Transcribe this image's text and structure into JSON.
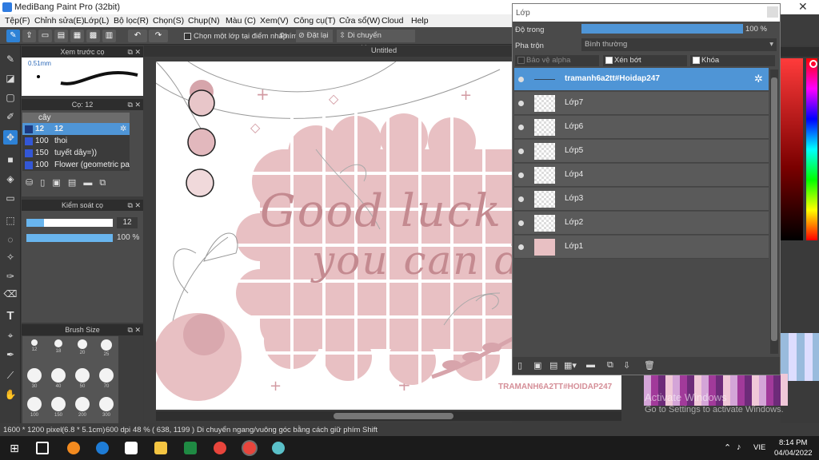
{
  "app": {
    "title": "MediBang Paint Pro (32bit)",
    "close": "✕"
  },
  "menu": [
    "Tệp(F)",
    "Chỉnh sửa(E)",
    "Lớp(L)",
    "Bộ lọc(R)",
    "Chọn(S)",
    "Chụp(N)",
    "Màu (C)",
    "Xem(V)",
    "Công cụ(T)",
    "Cửa sổ(W)",
    "Cloud",
    "Help"
  ],
  "toolbar": {
    "checkbox_label": "Chọn một lớp tại điểm nhấp",
    "snap_label": "Phím",
    "reset_label": "Đặt lại",
    "move_label": "Di chuyển ngang/dọc"
  },
  "preview": {
    "title": "Xem trước cọ",
    "size": "0.51mm"
  },
  "brush_panel": {
    "title": "Cọ: 12",
    "group": "cây",
    "items": [
      {
        "size": "12",
        "name": "12",
        "selected": true
      },
      {
        "size": "100",
        "name": "thoi"
      },
      {
        "size": "150",
        "name": "tuyết dây=))"
      },
      {
        "size": "100",
        "name": "Flower (geometric patt"
      }
    ]
  },
  "control": {
    "title": "Kiểm soát cọ",
    "size_value": "12",
    "opacity_value": "100 %",
    "size_fraction": 0.2,
    "opacity_fraction": 1.0
  },
  "brush_size": {
    "title": "Brush Size",
    "sizes": [
      "12",
      "18",
      "20",
      "25",
      "30",
      "40",
      "50",
      "70",
      "100",
      "150",
      "200",
      "300"
    ]
  },
  "canvas": {
    "title": "Untitled",
    "line1": "Good luck",
    "line2": "you can do",
    "watermark": "TRAMANH6A2TT#HOIDAP247"
  },
  "layer_window": {
    "title": "Lớp",
    "opacity_label": "Độ trong",
    "opacity_value": "100 %",
    "blend_label": "Pha trộn",
    "blend_value": "Bình thường",
    "protect_alpha": "Bảo vệ alpha",
    "clip": "Xén bớt",
    "lock": "Khóa",
    "layers": [
      {
        "name": "tramanh6a2tt#Hoidap247",
        "selected": true
      },
      {
        "name": "Lớp7"
      },
      {
        "name": "Lớp6"
      },
      {
        "name": "Lớp5"
      },
      {
        "name": "Lớp4"
      },
      {
        "name": "Lớp3"
      },
      {
        "name": "Lớp2"
      },
      {
        "name": "Lớp1"
      }
    ]
  },
  "activate": {
    "line1": "Activate Windows",
    "line2": "Go to Settings to activate Windows."
  },
  "status": {
    "dimensions": "1600 * 1200 pixel",
    "size_cm": "(6.8 * 5.1cm)",
    "dpi": "600 dpi",
    "zoom": "48 %",
    "coords": "( 638, 1199 )",
    "hint": "Di chuyển ngang/vuông góc bằng cách giữ phím Shift"
  },
  "taskbar": {
    "time": "8:14 PM",
    "date": "04/04/2022",
    "lang": "VIE"
  },
  "colors": {
    "accent": "#2e82d6",
    "pink": "#e8c0c3",
    "text_pink": "#c48a90"
  }
}
